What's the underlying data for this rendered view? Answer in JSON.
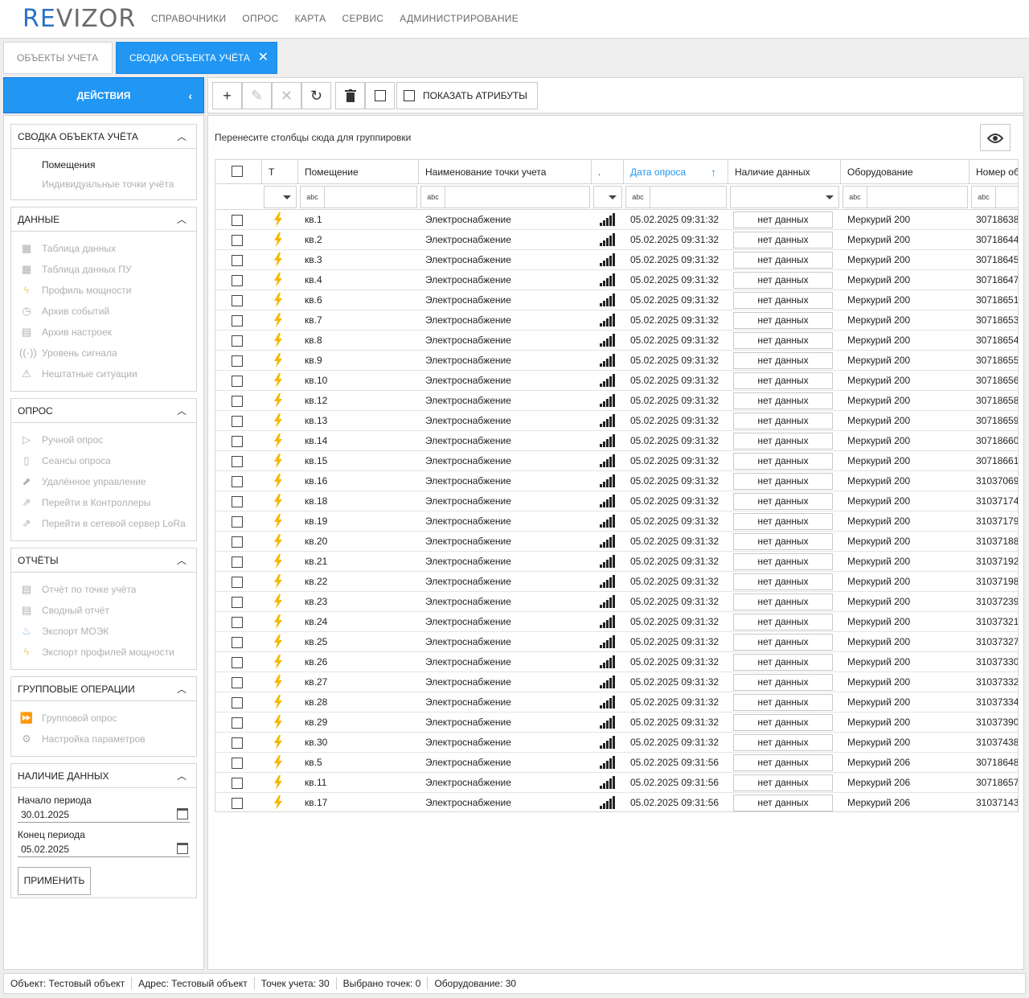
{
  "app": {
    "logo_part1": "RE",
    "logo_part2": "VIZOR",
    "menu": [
      "СПРАВОЧНИКИ",
      "ОПРОС",
      "КАРТА",
      "СЕРВИС",
      "АДМИНИСТРИРОВАНИЕ"
    ]
  },
  "tabs": [
    {
      "label": "ОБЪЕКТЫ УЧЕТА",
      "active": false
    },
    {
      "label": "СВОДКА ОБЪЕКТА УЧЁТА",
      "active": true
    }
  ],
  "actions_label": "ДЕЙСТВИЯ",
  "sidebar": {
    "summary": {
      "title": "СВОДКА ОБЪЕКТА УЧЁТА",
      "items": [
        "Помещения",
        "Индивидуальные точки учёта"
      ]
    },
    "data": {
      "title": "ДАННЫЕ",
      "items": [
        {
          "label": "Таблица данных",
          "icon": "table-icon"
        },
        {
          "label": "Таблица данных ПУ",
          "icon": "table-icon"
        },
        {
          "label": "Профиль мощности",
          "icon": "power-profile-icon"
        },
        {
          "label": "Архив событий",
          "icon": "clock-icon"
        },
        {
          "label": "Архив настроек",
          "icon": "printer-icon"
        },
        {
          "label": "Уровень сигнала",
          "icon": "antenna-icon"
        },
        {
          "label": "Нештатные ситуации",
          "icon": "warning-icon"
        }
      ]
    },
    "poll": {
      "title": "ОПРОС",
      "items": [
        {
          "label": "Ручной опрос",
          "icon": "play-icon"
        },
        {
          "label": "Сеансы опроса",
          "icon": "document-icon"
        },
        {
          "label": "Удалённое управление",
          "icon": "remote-icon"
        },
        {
          "label": "Перейти в Контроллеры",
          "icon": "external-link-icon"
        },
        {
          "label": "Перейти в сетевой сервер LoRa",
          "icon": "external-link-icon"
        }
      ]
    },
    "reports": {
      "title": "ОТЧЁТЫ",
      "items": [
        {
          "label": "Отчёт по точке учёта",
          "icon": "report-icon"
        },
        {
          "label": "Сводный отчёт",
          "icon": "report-icon"
        },
        {
          "label": "Экспорт МОЭК",
          "icon": "flame-icon"
        },
        {
          "label": "Экспорт профилей мощности",
          "icon": "bolt-export-icon"
        }
      ]
    },
    "group_ops": {
      "title": "ГРУППОВЫЕ ОПЕРАЦИИ",
      "items": [
        {
          "label": "Групповой опрос",
          "icon": "fast-forward-icon"
        },
        {
          "label": "Настройка параметров",
          "icon": "gear-icon"
        }
      ]
    },
    "availability": {
      "title": "НАЛИЧИЕ ДАННЫХ",
      "start_label": "Начало периода",
      "start_value": "30.01.2025",
      "end_label": "Конец периода",
      "end_value": "05.02.2025",
      "apply_label": "ПРИМЕНИТЬ"
    }
  },
  "toolbar": {
    "show_attributes_label": "ПОКАЗАТЬ АТРИБУТЫ"
  },
  "grid": {
    "group_hint": "Перенесите столбцы сюда для группировки",
    "columns": {
      "type": "Т",
      "room": "Помещение",
      "point_name": "Наименование точки учета",
      "signal": ".",
      "poll_date": "Дата опроса",
      "data_avail": "Наличие данных",
      "equipment": "Оборудование",
      "serial": "Номер об"
    },
    "filter_abc": "abc",
    "rows": [
      {
        "room": "кв.1",
        "name": "Электроснабжение",
        "date": "05.02.2025 09:31:32",
        "avail": "нет данных",
        "equip": "Меркурий 200",
        "serial": "30718638"
      },
      {
        "room": "кв.2",
        "name": "Электроснабжение",
        "date": "05.02.2025 09:31:32",
        "avail": "нет данных",
        "equip": "Меркурий 200",
        "serial": "30718644"
      },
      {
        "room": "кв.3",
        "name": "Электроснабжение",
        "date": "05.02.2025 09:31:32",
        "avail": "нет данных",
        "equip": "Меркурий 200",
        "serial": "30718645"
      },
      {
        "room": "кв.4",
        "name": "Электроснабжение",
        "date": "05.02.2025 09:31:32",
        "avail": "нет данных",
        "equip": "Меркурий 200",
        "serial": "30718647"
      },
      {
        "room": "кв.6",
        "name": "Электроснабжение",
        "date": "05.02.2025 09:31:32",
        "avail": "нет данных",
        "equip": "Меркурий 200",
        "serial": "30718651"
      },
      {
        "room": "кв.7",
        "name": "Электроснабжение",
        "date": "05.02.2025 09:31:32",
        "avail": "нет данных",
        "equip": "Меркурий 200",
        "serial": "30718653"
      },
      {
        "room": "кв.8",
        "name": "Электроснабжение",
        "date": "05.02.2025 09:31:32",
        "avail": "нет данных",
        "equip": "Меркурий 200",
        "serial": "30718654"
      },
      {
        "room": "кв.9",
        "name": "Электроснабжение",
        "date": "05.02.2025 09:31:32",
        "avail": "нет данных",
        "equip": "Меркурий 200",
        "serial": "30718655"
      },
      {
        "room": "кв.10",
        "name": "Электроснабжение",
        "date": "05.02.2025 09:31:32",
        "avail": "нет данных",
        "equip": "Меркурий 200",
        "serial": "30718656"
      },
      {
        "room": "кв.12",
        "name": "Электроснабжение",
        "date": "05.02.2025 09:31:32",
        "avail": "нет данных",
        "equip": "Меркурий 200",
        "serial": "30718658"
      },
      {
        "room": "кв.13",
        "name": "Электроснабжение",
        "date": "05.02.2025 09:31:32",
        "avail": "нет данных",
        "equip": "Меркурий 200",
        "serial": "30718659"
      },
      {
        "room": "кв.14",
        "name": "Электроснабжение",
        "date": "05.02.2025 09:31:32",
        "avail": "нет данных",
        "equip": "Меркурий 200",
        "serial": "30718660"
      },
      {
        "room": "кв.15",
        "name": "Электроснабжение",
        "date": "05.02.2025 09:31:32",
        "avail": "нет данных",
        "equip": "Меркурий 200",
        "serial": "30718661"
      },
      {
        "room": "кв.16",
        "name": "Электроснабжение",
        "date": "05.02.2025 09:31:32",
        "avail": "нет данных",
        "equip": "Меркурий 200",
        "serial": "31037069"
      },
      {
        "room": "кв.18",
        "name": "Электроснабжение",
        "date": "05.02.2025 09:31:32",
        "avail": "нет данных",
        "equip": "Меркурий 200",
        "serial": "31037174"
      },
      {
        "room": "кв.19",
        "name": "Электроснабжение",
        "date": "05.02.2025 09:31:32",
        "avail": "нет данных",
        "equip": "Меркурий 200",
        "serial": "31037179"
      },
      {
        "room": "кв.20",
        "name": "Электроснабжение",
        "date": "05.02.2025 09:31:32",
        "avail": "нет данных",
        "equip": "Меркурий 200",
        "serial": "31037188"
      },
      {
        "room": "кв.21",
        "name": "Электроснабжение",
        "date": "05.02.2025 09:31:32",
        "avail": "нет данных",
        "equip": "Меркурий 200",
        "serial": "31037192"
      },
      {
        "room": "кв.22",
        "name": "Электроснабжение",
        "date": "05.02.2025 09:31:32",
        "avail": "нет данных",
        "equip": "Меркурий 200",
        "serial": "31037198"
      },
      {
        "room": "кв.23",
        "name": "Электроснабжение",
        "date": "05.02.2025 09:31:32",
        "avail": "нет данных",
        "equip": "Меркурий 200",
        "serial": "31037239"
      },
      {
        "room": "кв.24",
        "name": "Электроснабжение",
        "date": "05.02.2025 09:31:32",
        "avail": "нет данных",
        "equip": "Меркурий 200",
        "serial": "31037321"
      },
      {
        "room": "кв.25",
        "name": "Электроснабжение",
        "date": "05.02.2025 09:31:32",
        "avail": "нет данных",
        "equip": "Меркурий 200",
        "serial": "31037327"
      },
      {
        "room": "кв.26",
        "name": "Электроснабжение",
        "date": "05.02.2025 09:31:32",
        "avail": "нет данных",
        "equip": "Меркурий 200",
        "serial": "31037330"
      },
      {
        "room": "кв.27",
        "name": "Электроснабжение",
        "date": "05.02.2025 09:31:32",
        "avail": "нет данных",
        "equip": "Меркурий 200",
        "serial": "31037332"
      },
      {
        "room": "кв.28",
        "name": "Электроснабжение",
        "date": "05.02.2025 09:31:32",
        "avail": "нет данных",
        "equip": "Меркурий 200",
        "serial": "31037334"
      },
      {
        "room": "кв.29",
        "name": "Электроснабжение",
        "date": "05.02.2025 09:31:32",
        "avail": "нет данных",
        "equip": "Меркурий 200",
        "serial": "31037390"
      },
      {
        "room": "кв.30",
        "name": "Электроснабжение",
        "date": "05.02.2025 09:31:32",
        "avail": "нет данных",
        "equip": "Меркурий 200",
        "serial": "31037438"
      },
      {
        "room": "кв.5",
        "name": "Электроснабжение",
        "date": "05.02.2025 09:31:56",
        "avail": "нет данных",
        "equip": "Меркурий 206",
        "serial": "30718648"
      },
      {
        "room": "кв.11",
        "name": "Электроснабжение",
        "date": "05.02.2025 09:31:56",
        "avail": "нет данных",
        "equip": "Меркурий 206",
        "serial": "30718657"
      },
      {
        "room": "кв.17",
        "name": "Электроснабжение",
        "date": "05.02.2025 09:31:56",
        "avail": "нет данных",
        "equip": "Меркурий 206",
        "serial": "31037143"
      }
    ]
  },
  "status_bar": [
    "Объект: Тестовый объект",
    "Адрес: Тестовый объект",
    "Точек учета: 30",
    "Выбрано точек: 0",
    "Оборудование: 30"
  ],
  "colors": {
    "accent": "#2196f3",
    "bolt": "#f5b800"
  }
}
